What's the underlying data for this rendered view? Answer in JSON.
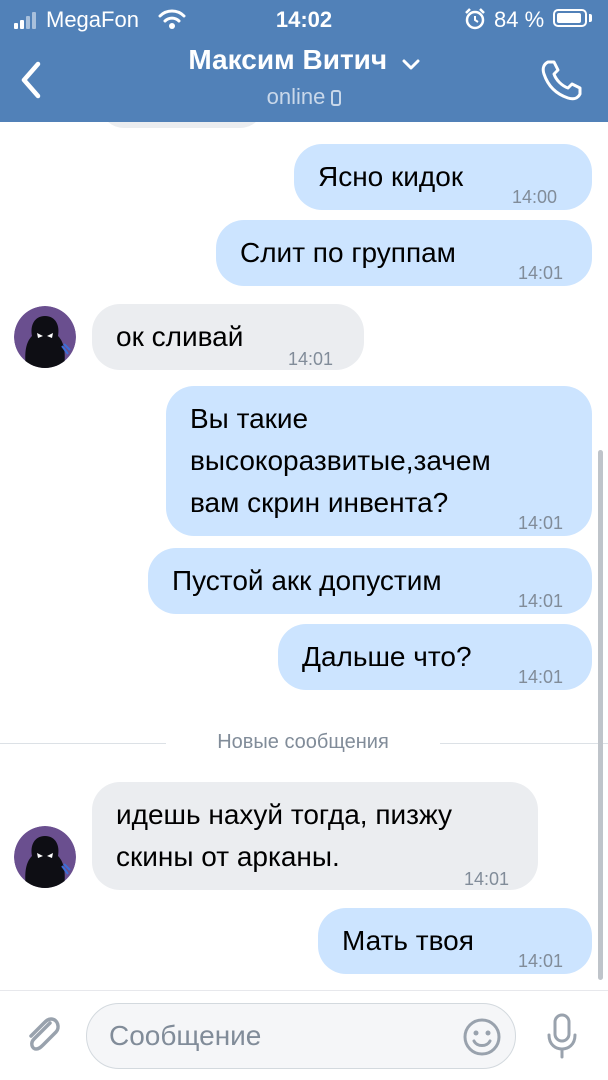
{
  "status": {
    "carrier": "MegaFon",
    "time": "14:02",
    "battery": "84 %"
  },
  "header": {
    "title": "Максим Витич",
    "subtitle": "online"
  },
  "messages": [
    {
      "text": "Ясно кидок",
      "time": "14:00"
    },
    {
      "text": "Слит по группам",
      "time": "14:01"
    },
    {
      "text": "ок сливай",
      "time": "14:01"
    },
    {
      "text": "Вы такие\nвысокоразвитые,зачем\nвам скрин инвента?",
      "time": "14:01"
    },
    {
      "text": "Пустой акк допустим",
      "time": "14:01"
    },
    {
      "text": "Дальше что?",
      "time": "14:01"
    },
    {
      "text": "идешь нахуй тогда, пизжу\nскины от арканы.",
      "time": "14:01"
    },
    {
      "text": "Мать твоя",
      "time": "14:01"
    }
  ],
  "divider": "Новые сообщения",
  "composer": {
    "placeholder": "Сообщение"
  },
  "colors": {
    "header": "#5181b8",
    "outgoing": "#cce4ff",
    "incoming": "#ebedf0"
  },
  "icons": [
    "signal-icon",
    "wifi-icon",
    "alarm-icon",
    "battery-icon",
    "back-icon",
    "chevron-down-icon",
    "phone-icon",
    "call-icon",
    "attach-icon",
    "emoji-icon",
    "mic-icon"
  ]
}
